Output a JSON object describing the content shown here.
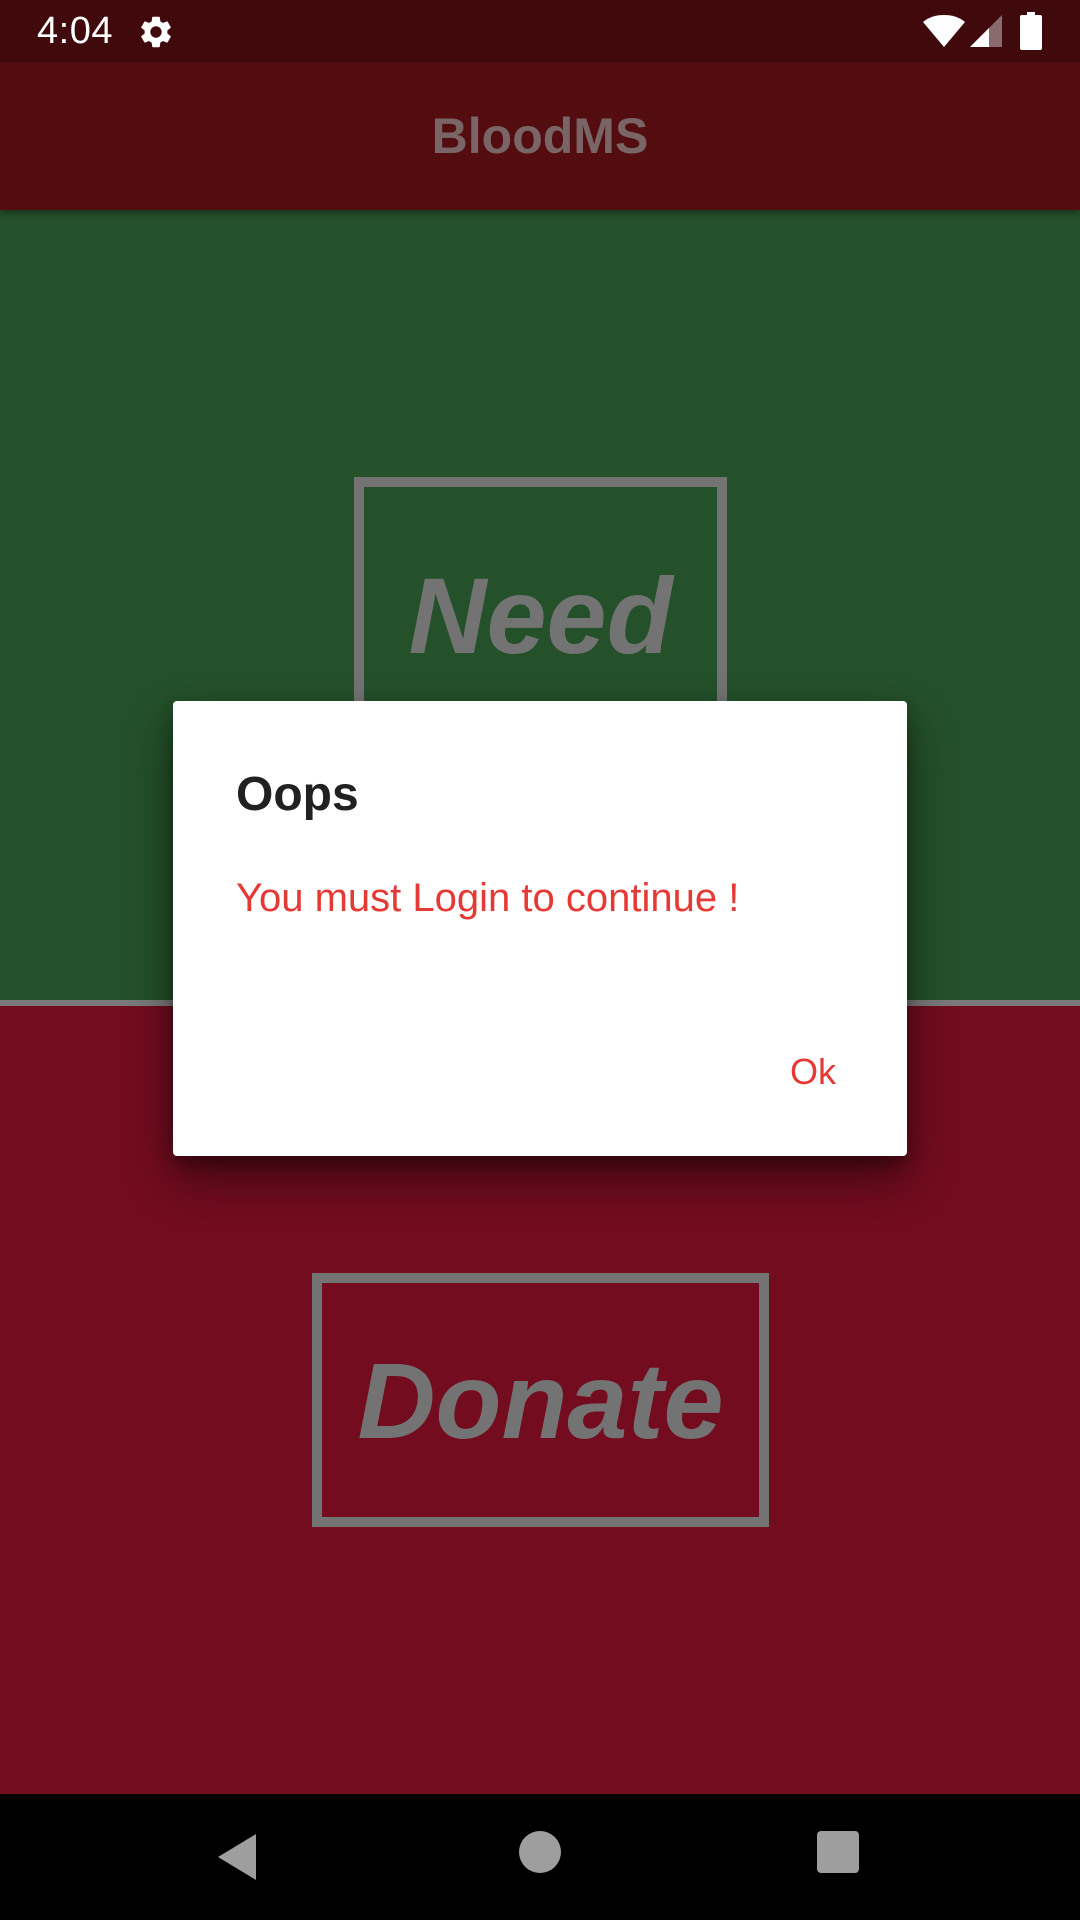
{
  "status_bar": {
    "time": "4:04",
    "icons": [
      "gear-icon",
      "wifi-icon",
      "signal-icon",
      "battery-icon"
    ]
  },
  "app_bar": {
    "title": "BloodMS"
  },
  "main": {
    "need_label": "Need",
    "donate_label": "Donate"
  },
  "dialog": {
    "title": "Oops",
    "message": "You must Login to continue !",
    "ok_label": "Ok"
  },
  "nav_bar": {
    "icons": [
      "back-icon",
      "home-icon",
      "recents-icon"
    ]
  },
  "colors": {
    "status_bar": "#400a0d",
    "app_bar": "#530d10",
    "need_panel": "#24502a",
    "donate_panel": "#730c1f",
    "accent": "#e53935",
    "button_outline": "#737373"
  }
}
